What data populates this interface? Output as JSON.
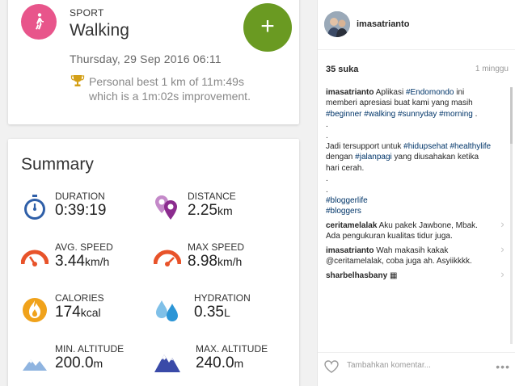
{
  "workout": {
    "sport_label": "SPORT",
    "sport_name": "Walking",
    "add_label": "+",
    "date": "Thursday, 29 Sep 2016 06:11",
    "pb_line1": "Personal best 1 km of 11m:49s",
    "pb_line2": "which is a 1m:02s improvement."
  },
  "summary": {
    "title": "Summary",
    "stats": [
      {
        "label": "DURATION",
        "value": "0:39:19",
        "unit": ""
      },
      {
        "label": "DISTANCE",
        "value": "2.25",
        "unit": "km"
      },
      {
        "label": "AVG. SPEED",
        "value": "3.44",
        "unit": "km/h"
      },
      {
        "label": "MAX SPEED",
        "value": "8.98",
        "unit": "km/h"
      },
      {
        "label": "CALORIES",
        "value": "174",
        "unit": "kcal"
      },
      {
        "label": "HYDRATION",
        "value": "0.35",
        "unit": "L"
      },
      {
        "label": "MIN. ALTITUDE",
        "value": "200.0",
        "unit": "m"
      },
      {
        "label": "MAX. ALTITUDE",
        "value": "240.0",
        "unit": "m"
      }
    ]
  },
  "post": {
    "username": "imasatrianto",
    "likes": "35 suka",
    "time": "1 minggu",
    "caption": {
      "user": "imasatrianto",
      "text": "Aplikasi",
      "t1": "#Endomondo",
      "text2": "ini memberi apresiasi buat kami yang masih",
      "t2": "#beginner",
      "t3": "#walking",
      "t4": "#sunnyday",
      "t5": "#morning",
      "dot": ".",
      "text3": "Jadi tersupport untuk",
      "t6": "#hidupsehat",
      "t7": "#healthylife",
      "text4": "dengan",
      "t8": "#jalanpagi",
      "text5": "yang diusahakan ketika hari cerah.",
      "t9": "#bloggerlife",
      "t10": "#bloggers"
    },
    "comments": [
      {
        "user": "ceritamelalak",
        "text": "Aku pakek Jawbone, Mbak. Ada pengukuran kualitas tidur juga."
      },
      {
        "user": "imasatrianto",
        "text": "Wah makasih kakak @ceritamelalak, coba juga ah. Asyiikkkk."
      },
      {
        "user": "sharbelhasbany",
        "text": "▦"
      }
    ],
    "close_label": "✕",
    "add_comment_placeholder": "Tambahkan komentar...",
    "more_label": "•••"
  }
}
